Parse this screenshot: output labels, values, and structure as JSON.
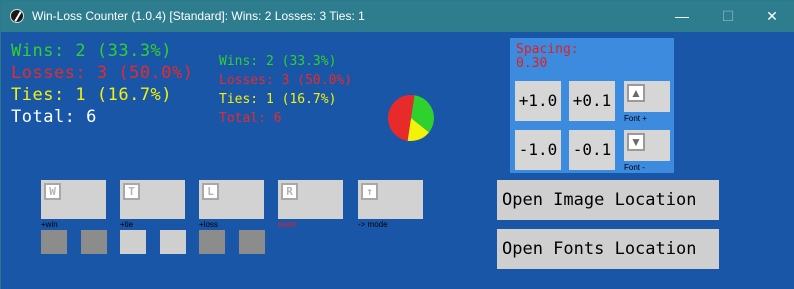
{
  "window": {
    "title": "Win-Loss Counter (1.0.4) [Standard]: Wins: 2 Losses: 3 Ties: 1",
    "minimize_glyph": "—",
    "maximize_glyph": "☐",
    "close_glyph": "✕"
  },
  "stats_large": {
    "wins": "Wins: 2 (33.3%)",
    "losses": "Losses: 3 (50.0%)",
    "ties": "Ties: 1 (16.7%)",
    "total": "Total: 6"
  },
  "stats_small": {
    "wins": "Wins: 2 (33.3%)",
    "losses": "Losses: 3 (50.0%)",
    "ties": "Ties: 1 (16.7%)",
    "total": "Total: 6"
  },
  "colors": {
    "wins": "#2fd12f",
    "losses": "#e82a2a",
    "ties": "#f2f20a",
    "total": "#ffffff",
    "background": "#1a56a8",
    "panel": "#3d8bdf"
  },
  "pie": {
    "slices": [
      {
        "label": "Wins",
        "value": 2,
        "color": "#2fd12f"
      },
      {
        "label": "Losses",
        "value": 3,
        "color": "#e82a2a"
      },
      {
        "label": "Ties",
        "value": 1,
        "color": "#f2f20a"
      }
    ]
  },
  "spacing": {
    "label": "Spacing:",
    "value": "0.30",
    "buttons": {
      "plus_1": "+1.0",
      "plus_01": "+0.1",
      "minus_1": "-1.0",
      "minus_01": "-0.1"
    },
    "font_plus_caption": "Font +",
    "font_minus_caption": "Font -",
    "font_plus_icon": "up-arrow-icon",
    "font_minus_icon": "down-arrow-icon"
  },
  "hotkeys": [
    {
      "key": "W",
      "caption": "+win",
      "caption_color": "#000000"
    },
    {
      "key": "T",
      "caption": "+tie",
      "caption_color": "#000000"
    },
    {
      "key": "L",
      "caption": "+loss",
      "caption_color": "#000000"
    },
    {
      "key": "R",
      "caption": "reset",
      "caption_color": "#e02020"
    },
    {
      "key": "↑",
      "caption": "-> mode",
      "caption_color": "#000000"
    }
  ],
  "swatches": [
    "#8c8c8c",
    "#8c8c8c",
    "#cfcfcf",
    "#cfcfcf",
    "#8c8c8c",
    "#8c8c8c"
  ],
  "actions": {
    "open_image": "Open Image Location",
    "open_fonts": "Open Fonts Location"
  }
}
